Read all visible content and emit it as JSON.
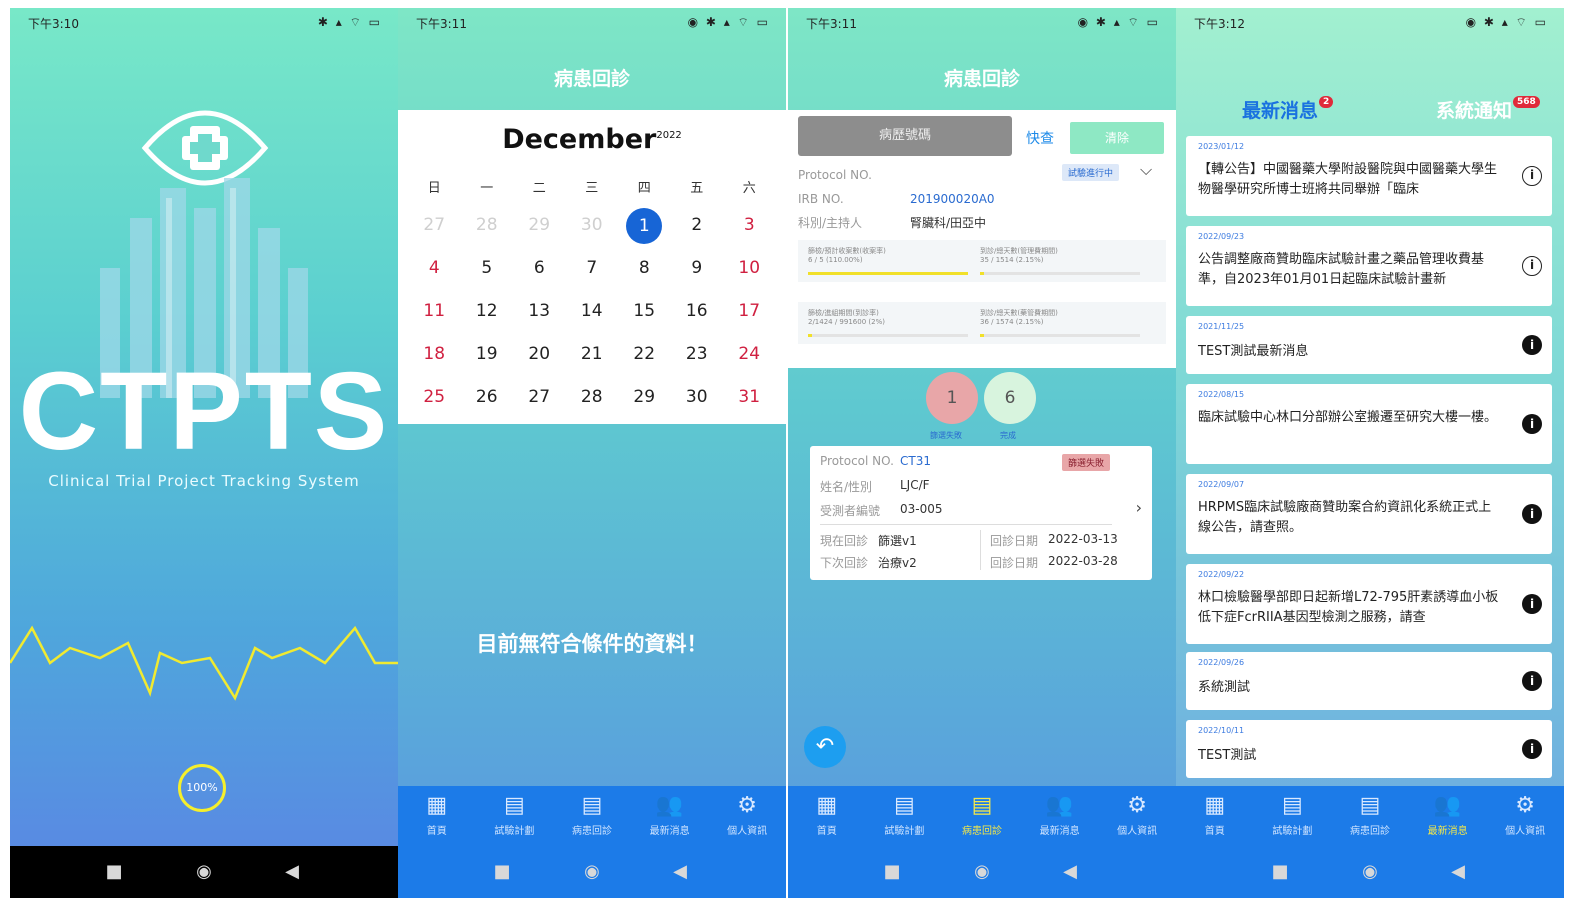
{
  "screens": {
    "splash": {
      "status_time": "下午3:10",
      "status_icons": "✱ ▴ ⌔ ▭",
      "title": "CTPTS",
      "subtitle": "Clinical Trial Project Tracking System",
      "progress": "100%"
    },
    "calendar": {
      "status_time": "下午3:11",
      "status_icons": "◉ ✱ ▴ ⌔ ▭",
      "header": "病患回診",
      "month": "December",
      "year": "2022",
      "weekdays": [
        "日",
        "一",
        "二",
        "三",
        "四",
        "五",
        "六"
      ],
      "weeks": [
        [
          "27",
          "28",
          "29",
          "30",
          "1",
          "2",
          "3"
        ],
        [
          "4",
          "5",
          "6",
          "7",
          "8",
          "9",
          "10"
        ],
        [
          "11",
          "12",
          "13",
          "14",
          "15",
          "16",
          "17"
        ],
        [
          "18",
          "19",
          "20",
          "21",
          "22",
          "23",
          "24"
        ],
        [
          "25",
          "26",
          "27",
          "28",
          "29",
          "30",
          "31"
        ]
      ],
      "empty_message": "目前無符合條件的資料！"
    },
    "patient_visit": {
      "status_time": "下午3:11",
      "status_icons": "◉ ✱ ▴ ⌔ ▭",
      "header": "病患回診",
      "btn_record": "病歷號碼",
      "btn_quick": "快查",
      "btn_clear": "清除",
      "protocol_label": "Protocol NO.",
      "status_pill": "試驗進行中",
      "irb_label": "IRB NO.",
      "irb_value": "201900020A0",
      "dept_label": "科別/主持人",
      "dept_value": "腎臟科/田亞中",
      "stats": [
        {
          "title": "篩檢/預計收案數(收案率)",
          "value": "6 / 5 (110.00%)",
          "progress": 1.0
        },
        {
          "title": "到診/總天數(管理費期間)",
          "value": "35 / 1514 (2.15%)",
          "progress": 0.02
        },
        {
          "title": "篩檢/進組期間(到診率)",
          "value": "2/1424 / 991600 (2%)",
          "progress": 0.0
        },
        {
          "title": "到診/總天數(藥管費期間)",
          "value": "36 / 1574 (2.15%)",
          "progress": 0.02
        }
      ],
      "counts": [
        {
          "value": "1",
          "label": "篩選失敗"
        },
        {
          "value": "6",
          "label": "完成"
        }
      ],
      "patient": {
        "protocol_label": "Protocol NO.",
        "protocol_value": "CT31",
        "status": "篩選失敗",
        "name_label": "姓名/性別",
        "name_value": "LJC/F",
        "subject_label": "受測者編號",
        "subject_value": "03-005",
        "current_label": "現在回診",
        "current_value": "篩選v1",
        "current_date_label": "回診日期",
        "current_date": "2022-03-13",
        "next_label": "下次回診",
        "next_value": "治療v2",
        "next_date_label": "回診日期",
        "next_date": "2022-03-28"
      }
    },
    "news": {
      "status_time": "下午3:12",
      "status_icons": "◉ ✱ ▴ ⌔ ▭",
      "tab_news": "最新消息",
      "tab_news_badge": "2",
      "tab_sys": "系統通知",
      "tab_sys_badge": "568",
      "items": [
        {
          "date": "2023/01/12",
          "title": "【轉公告】中國醫藥大學附設醫院與中國醫藥大學生物醫學研究所博士班將共同舉辦「臨床",
          "icon": "info-outline"
        },
        {
          "date": "2022/09/23",
          "title": "公告調整廠商贊助臨床試驗計畫之藥品管理收費基準，自2023年01月01日起臨床試驗計畫新",
          "icon": "info-outline"
        },
        {
          "date": "2021/11/25",
          "title": "TEST測試最新消息",
          "icon": "info-solid"
        },
        {
          "date": "2022/08/15",
          "title": "臨床試驗中心林口分部辦公室搬遷至研究大樓一樓。",
          "icon": "info-solid"
        },
        {
          "date": "2022/09/07",
          "title": "HRPMS臨床試驗廠商贊助案合約資訊化系統正式上線公告，請查照。",
          "icon": "info-solid"
        },
        {
          "date": "2022/09/22",
          "title": "林口檢驗醫學部即日起新增L72-795肝素誘導血小板低下症FcrRIIA基因型檢測之服務，請查",
          "icon": "info-solid"
        },
        {
          "date": "2022/09/26",
          "title": "系統測試",
          "icon": "info-solid"
        },
        {
          "date": "2022/10/11",
          "title": "TEST測試",
          "icon": "info-solid"
        }
      ]
    }
  },
  "tabbar": [
    "首頁",
    "試驗計劃",
    "病患回診",
    "最新消息",
    "個人資訊"
  ],
  "colors": {
    "accent_blue": "#1c7be8",
    "active_tab": "#f3e84a",
    "badge_red": "#e02a3a"
  }
}
